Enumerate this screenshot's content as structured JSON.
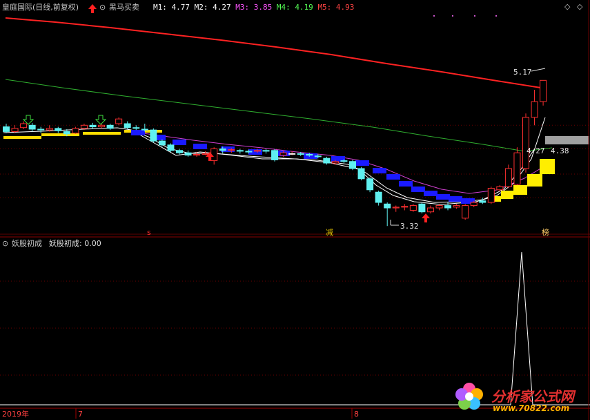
{
  "header": {
    "stock_name": "皇庭国际(日线,前复权)",
    "indicator_name": "黑马买卖",
    "ma": [
      {
        "label": "M1: 4.77",
        "color": "#ffffff"
      },
      {
        "label": "M2: 4.27",
        "color": "#ffffff"
      },
      {
        "label": "M3: 3.85",
        "color": "#ff55ff"
      },
      {
        "label": "M4: 4.19",
        "color": "#55ff55"
      },
      {
        "label": "M5: 4.93",
        "color": "#ff4444"
      }
    ]
  },
  "chart_labels": {
    "high": "5.17",
    "low": "3.32",
    "right_a": "4.27",
    "right_b": "4.38",
    "marker_s": "s",
    "marker_jian": "减",
    "marker_bang": "榜"
  },
  "sub_panel": {
    "title": "妖股初成",
    "value_label": "妖股初成: 0.00"
  },
  "axis": {
    "year": "2019年",
    "month_a": "7",
    "month_b": "8"
  },
  "watermark": {
    "name": "分析家公式网",
    "url": "www.70822.com"
  },
  "chart_data": {
    "type": "candlestick",
    "candles": [
      [
        4.58,
        4.52,
        4.62,
        4.5
      ],
      [
        4.52,
        4.56,
        4.6,
        4.5
      ],
      [
        4.57,
        4.62,
        4.65,
        4.55
      ],
      [
        4.6,
        4.55,
        4.63,
        4.52
      ],
      [
        4.55,
        4.54,
        4.58,
        4.5
      ],
      [
        4.54,
        4.56,
        4.6,
        4.52
      ],
      [
        4.56,
        4.53,
        4.58,
        4.5
      ],
      [
        4.52,
        4.49,
        4.55,
        4.46
      ],
      [
        4.5,
        4.56,
        4.58,
        4.49
      ],
      [
        4.56,
        4.6,
        4.62,
        4.54
      ],
      [
        4.6,
        4.58,
        4.63,
        4.55
      ],
      [
        4.58,
        4.6,
        4.62,
        4.56
      ],
      [
        4.6,
        4.56,
        4.62,
        4.54
      ],
      [
        4.62,
        4.68,
        4.7,
        4.6
      ],
      [
        4.62,
        4.57,
        4.65,
        4.55
      ],
      [
        4.57,
        4.56,
        4.6,
        4.54
      ],
      [
        4.55,
        4.54,
        4.62,
        4.52
      ],
      [
        4.54,
        4.4,
        4.56,
        4.38
      ],
      [
        4.4,
        4.35,
        4.42,
        4.33
      ],
      [
        4.35,
        4.28,
        4.37,
        4.26
      ],
      [
        4.28,
        4.25,
        4.3,
        4.23
      ],
      [
        4.25,
        4.22,
        4.28,
        4.2
      ],
      [
        4.22,
        4.23,
        4.26,
        4.2
      ],
      [
        4.23,
        4.24,
        4.27,
        4.22
      ],
      [
        4.15,
        4.3,
        4.32,
        4.1
      ],
      [
        4.3,
        4.28,
        4.33,
        4.24
      ],
      [
        4.28,
        4.29,
        4.31,
        4.25
      ],
      [
        4.28,
        4.27,
        4.3,
        4.24
      ],
      [
        4.27,
        4.26,
        4.29,
        4.24
      ],
      [
        4.27,
        4.28,
        4.3,
        4.25
      ],
      [
        4.28,
        4.27,
        4.3,
        4.24
      ],
      [
        4.28,
        4.16,
        4.3,
        4.14
      ],
      [
        4.22,
        4.25,
        4.27,
        4.2
      ],
      [
        4.24,
        4.24,
        4.27,
        4.22
      ],
      [
        4.24,
        4.23,
        4.26,
        4.21
      ],
      [
        4.23,
        4.22,
        4.25,
        4.2
      ],
      [
        4.21,
        4.2,
        4.23,
        4.18
      ],
      [
        4.18,
        4.12,
        4.2,
        4.1
      ],
      [
        4.12,
        4.14,
        4.16,
        4.1
      ],
      [
        4.15,
        4.14,
        4.17,
        4.12
      ],
      [
        4.14,
        4.05,
        4.16,
        4.03
      ],
      [
        4.05,
        3.92,
        4.07,
        3.9
      ],
      [
        3.92,
        3.78,
        3.94,
        3.75
      ],
      [
        3.75,
        3.62,
        3.77,
        3.58
      ],
      [
        3.6,
        3.55,
        3.62,
        3.32
      ],
      [
        3.55,
        3.56,
        3.58,
        3.5
      ],
      [
        3.56,
        3.57,
        3.6,
        3.52
      ],
      [
        3.52,
        3.58,
        3.6,
        3.5
      ],
      [
        3.6,
        3.5,
        3.62,
        3.48
      ],
      [
        3.5,
        3.55,
        3.58,
        3.48
      ],
      [
        3.55,
        3.58,
        3.6,
        3.52
      ],
      [
        3.58,
        3.55,
        3.62,
        3.52
      ],
      [
        3.56,
        3.58,
        3.6,
        3.54
      ],
      [
        3.42,
        3.58,
        3.6,
        3.4
      ],
      [
        3.58,
        3.62,
        3.64,
        3.56
      ],
      [
        3.64,
        3.62,
        3.68,
        3.6
      ],
      [
        3.62,
        3.8,
        3.82,
        3.6
      ],
      [
        3.78,
        3.82,
        3.84,
        3.76
      ],
      [
        3.82,
        4.05,
        4.1,
        3.8
      ],
      [
        3.85,
        4.25,
        4.32,
        3.84
      ],
      [
        4.05,
        4.7,
        4.75,
        4.0
      ],
      [
        4.7,
        4.9,
        5.05,
        4.6
      ],
      [
        4.9,
        5.17,
        5.17,
        4.85
      ]
    ],
    "hlines": [
      4.6,
      4.3,
      3.98,
      3.68
    ]
  }
}
